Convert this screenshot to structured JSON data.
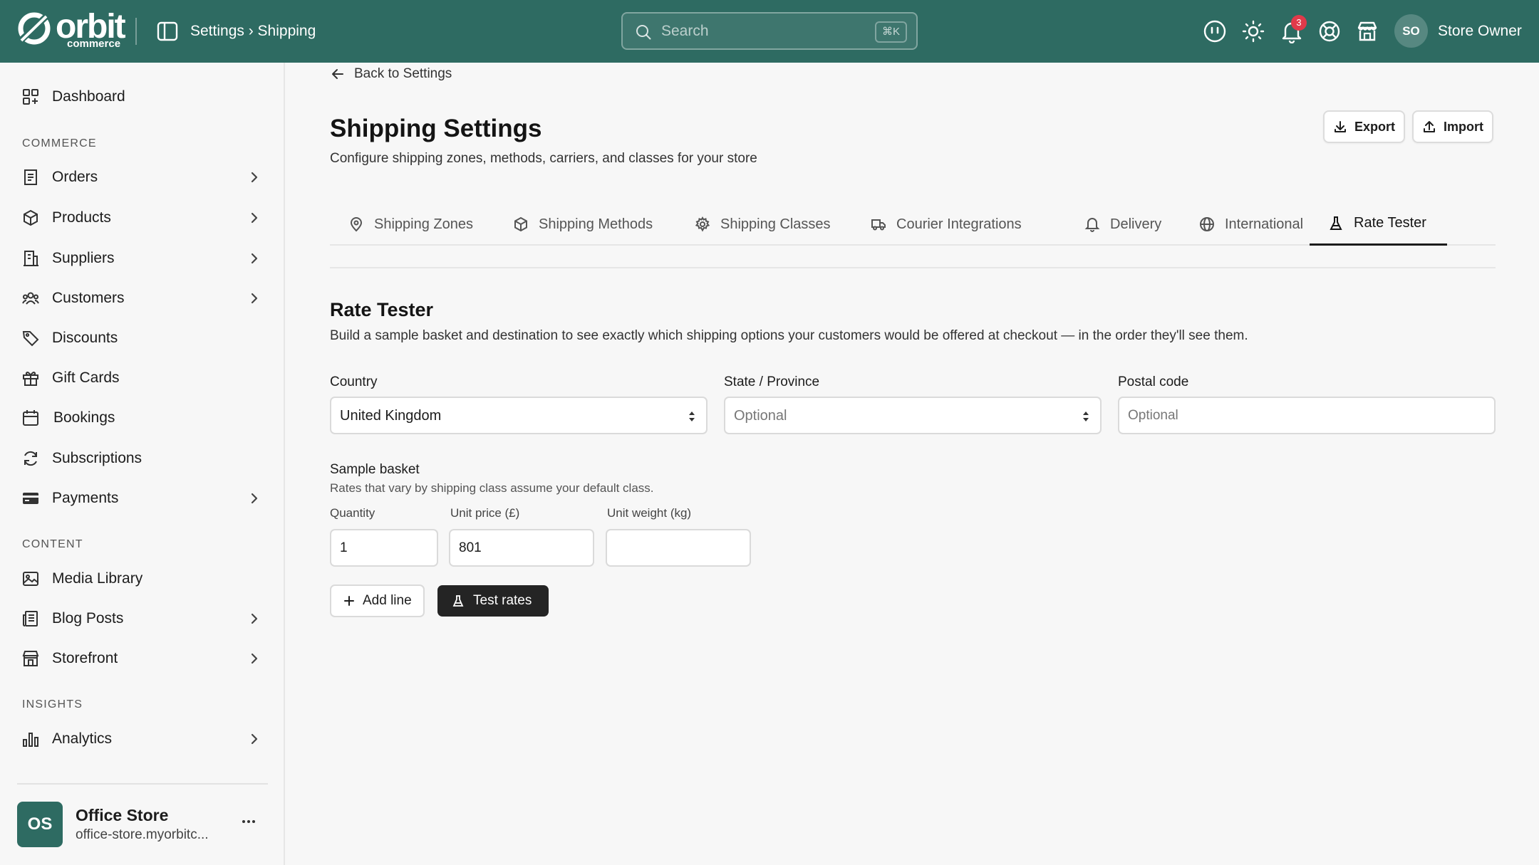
{
  "brand": {
    "name": "orbit",
    "sub": "commerce"
  },
  "header": {
    "breadcrumb": "Settings › Shipping",
    "search_placeholder": "Search",
    "search_shortcut": "⌘K",
    "notifications_count": "3",
    "user_initials": "SO",
    "user_name": "Store Owner"
  },
  "sidebar": {
    "dashboard": "Dashboard",
    "sections": {
      "commerce": "COMMERCE",
      "content": "CONTENT",
      "insights": "INSIGHTS"
    },
    "commerce_items": [
      "Orders",
      "Products",
      "Suppliers",
      "Customers",
      "Discounts",
      "Gift Cards",
      "Bookings",
      "Subscriptions",
      "Payments"
    ],
    "content_items": [
      "Media Library",
      "Blog Posts",
      "Storefront"
    ],
    "insights_items": [
      "Analytics"
    ],
    "store": {
      "initials": "OS",
      "name": "Office Store",
      "url": "office-store.myorbitc..."
    }
  },
  "page": {
    "back_label": "Back to Settings",
    "title": "Shipping Settings",
    "subtitle": "Configure shipping zones, methods, carriers, and classes for your store",
    "export_label": "Export",
    "import_label": "Import",
    "tabs": [
      "Shipping Zones",
      "Shipping Methods",
      "Shipping Classes",
      "Courier Integrations",
      "Delivery",
      "International",
      "Rate Tester"
    ],
    "active_tab": "Rate Tester"
  },
  "rate_tester": {
    "title": "Rate Tester",
    "description": "Build a sample basket and destination to see exactly which shipping options your customers would be offered at checkout — in the order they'll see them.",
    "country_label": "Country",
    "country_value": "United Kingdom",
    "state_label": "State / Province",
    "state_placeholder": "Optional",
    "postal_label": "Postal code",
    "postal_placeholder": "Optional",
    "basket_title": "Sample basket",
    "basket_help": "Rates that vary by shipping class assume your default class.",
    "quantity_label": "Quantity",
    "quantity_value": "1",
    "unit_price_label": "Unit price (£)",
    "unit_price_value": "801",
    "unit_weight_label": "Unit weight (kg)",
    "unit_weight_value": "",
    "add_line_label": "Add line",
    "test_rates_label": "Test rates"
  }
}
